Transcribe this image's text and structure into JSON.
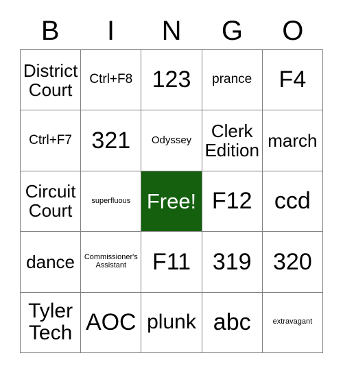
{
  "card": {
    "title_letters": [
      "B",
      "I",
      "N",
      "G",
      "O"
    ],
    "free_space_color": "#14600f",
    "free_space_text_color": "#ffffff",
    "grid_line_color": "#808080",
    "text_color": "#000000",
    "background_color": "#ffffff"
  },
  "rows": [
    [
      {
        "text": "District\nCourt",
        "size": "lg",
        "free": false
      },
      {
        "text": "Ctrl+F8",
        "size": "md",
        "free": false
      },
      {
        "text": "123",
        "size": "xxl",
        "free": false
      },
      {
        "text": "prance",
        "size": "md",
        "free": false
      },
      {
        "text": "F4",
        "size": "xxl",
        "free": false
      }
    ],
    [
      {
        "text": "Ctrl+F7",
        "size": "md",
        "free": false
      },
      {
        "text": "321",
        "size": "xxl",
        "free": false
      },
      {
        "text": "Odyssey",
        "size": "sm",
        "free": false
      },
      {
        "text": "Clerk\nEdition",
        "size": "lg",
        "free": false
      },
      {
        "text": "march",
        "size": "lg",
        "free": false
      }
    ],
    [
      {
        "text": "Circuit\nCourt",
        "size": "lg",
        "free": false
      },
      {
        "text": "superfluous",
        "size": "xs",
        "free": false
      },
      {
        "text": "Free!",
        "size": "xl",
        "free": true
      },
      {
        "text": "F12",
        "size": "xxl",
        "free": false
      },
      {
        "text": "ccd",
        "size": "xxl",
        "free": false
      }
    ],
    [
      {
        "text": "dance",
        "size": "lg",
        "free": false
      },
      {
        "text": "Commissioner's\nAssistant",
        "size": "xs",
        "free": false
      },
      {
        "text": "F11",
        "size": "xxl",
        "free": false
      },
      {
        "text": "319",
        "size": "xxl",
        "free": false
      },
      {
        "text": "320",
        "size": "xxl",
        "free": false
      }
    ],
    [
      {
        "text": "Tyler\nTech",
        "size": "xl",
        "free": false
      },
      {
        "text": "AOC",
        "size": "xxl",
        "free": false
      },
      {
        "text": "plunk",
        "size": "xl",
        "free": false
      },
      {
        "text": "abc",
        "size": "xxl",
        "free": false
      },
      {
        "text": "extravagant",
        "size": "xs",
        "free": false
      }
    ]
  ]
}
